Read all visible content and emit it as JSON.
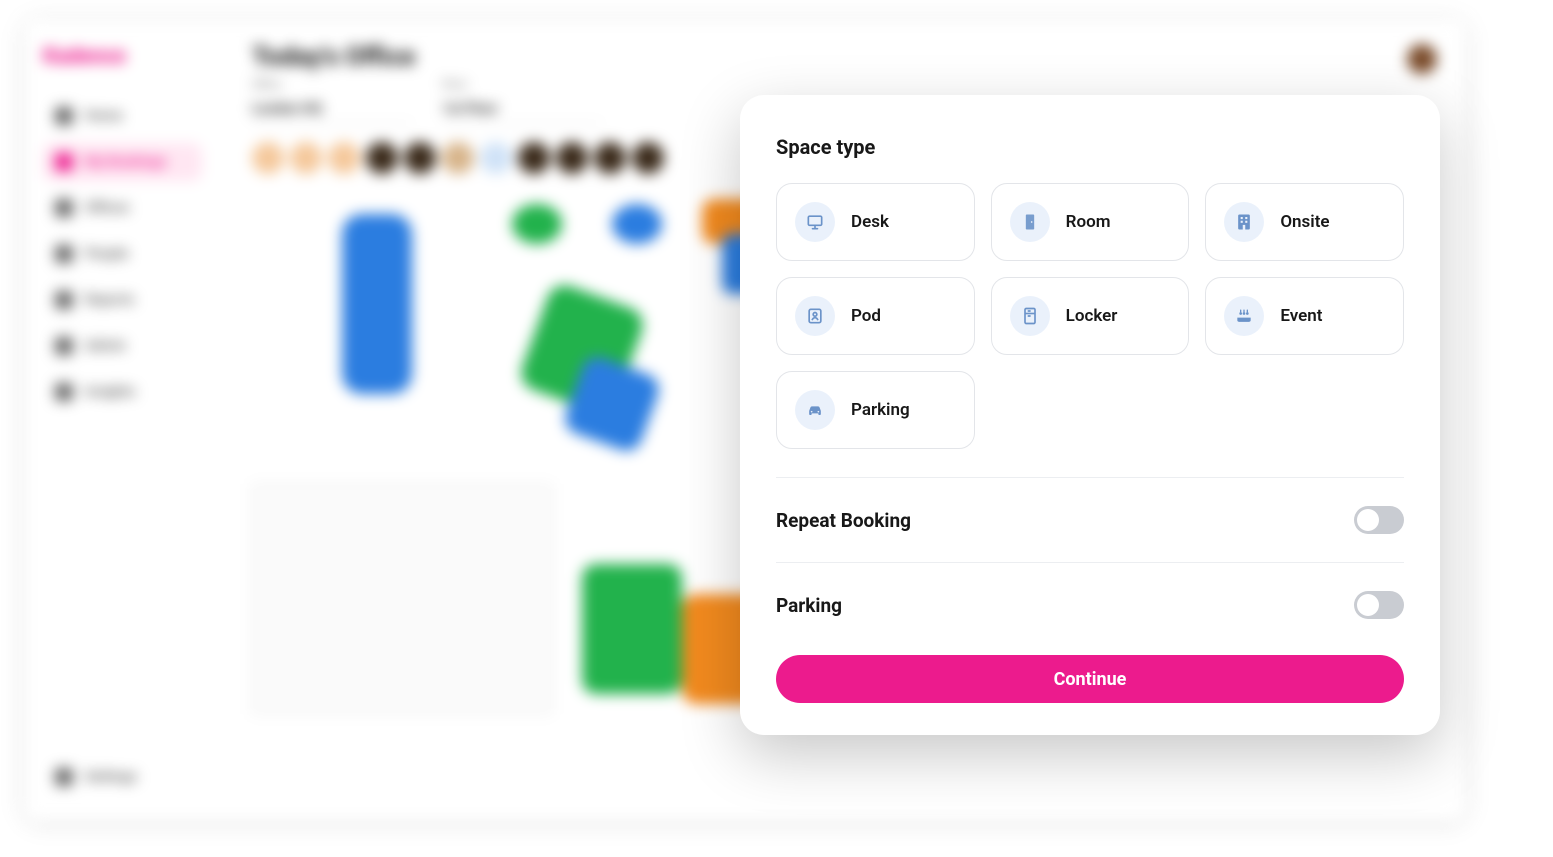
{
  "logo": "Kadence",
  "sidebar": {
    "items": [
      {
        "label": "Home",
        "active": false
      },
      {
        "label": "My Bookings",
        "active": true
      },
      {
        "label": "Offices",
        "active": false
      },
      {
        "label": "People",
        "active": false
      },
      {
        "label": "Reports",
        "active": false
      },
      {
        "label": "Admin",
        "active": false
      },
      {
        "label": "Insights",
        "active": false
      }
    ],
    "footer": {
      "label": "Settings"
    }
  },
  "header": {
    "title": "Today's Office"
  },
  "filters": [
    {
      "label": "Office",
      "value": "London HQ"
    },
    {
      "label": "Floor",
      "value": "1st Floor"
    }
  ],
  "modal": {
    "title": "Space type",
    "types": [
      {
        "key": "desk",
        "label": "Desk"
      },
      {
        "key": "room",
        "label": "Room"
      },
      {
        "key": "onsite",
        "label": "Onsite"
      },
      {
        "key": "pod",
        "label": "Pod"
      },
      {
        "key": "locker",
        "label": "Locker"
      },
      {
        "key": "event",
        "label": "Event"
      },
      {
        "key": "parking",
        "label": "Parking"
      }
    ],
    "toggles": [
      {
        "key": "repeat",
        "label": "Repeat Booking",
        "on": false
      },
      {
        "key": "parking",
        "label": "Parking",
        "on": false
      }
    ],
    "continue": "Continue"
  },
  "colors": {
    "accent": "#ec1b8d",
    "iconbg": "#eaf1fb",
    "iconfg": "#6b93c9"
  }
}
